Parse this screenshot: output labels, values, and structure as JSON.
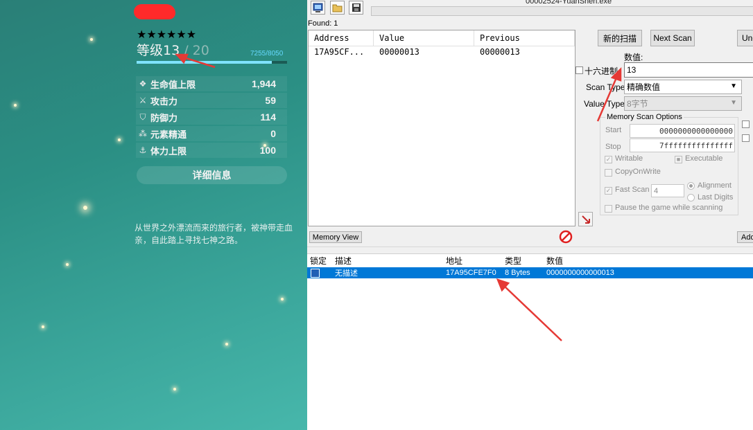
{
  "game": {
    "stars": "★★★★★★",
    "level_label": "等级13",
    "level_max": " / 20",
    "exp": "7255/8050",
    "exp_fraction": 0.9,
    "stats": [
      {
        "icon": "hp-icon",
        "name": "生命值上限",
        "value": "1,944"
      },
      {
        "icon": "sword-icon",
        "name": "攻击力",
        "value": "59"
      },
      {
        "icon": "shield-icon",
        "name": "防御力",
        "value": "114"
      },
      {
        "icon": "element-icon",
        "name": "元素精通",
        "value": "0"
      },
      {
        "icon": "stamina-icon",
        "name": "体力上限",
        "value": "100"
      }
    ],
    "detail_button": "详细信息",
    "description": "从世界之外漂流而来的旅行者，被神带走血亲，自此踏上寻找七神之路。"
  },
  "ce": {
    "window_title": "00002524-YuanShen.exe",
    "found": "Found: 1",
    "results_headers": [
      "Address",
      "Value",
      "Previous"
    ],
    "results_rows": [
      {
        "address": "17A95CF...",
        "value": "00000013",
        "previous": "00000013"
      }
    ],
    "new_scan_button": "新的扫描",
    "next_scan_button": "Next Scan",
    "undo_scan_button": "Und",
    "value_label": "数值:",
    "hex_label": "十六进制",
    "value_input": "13",
    "scan_type_label": "Scan Type",
    "scan_type_value": "精确数值",
    "value_type_label": "Value Type",
    "value_type_value": "8字节",
    "memory_scan_options": "Memory Scan Options",
    "start_label": "Start",
    "start_value": "0000000000000000",
    "stop_label": "Stop",
    "stop_value": "7fffffffffffffff",
    "writable_label": "Writable",
    "executable_label": "Executable",
    "copyonwrite_label": "CopyOnWrite",
    "fast_scan_label": "Fast Scan",
    "fast_scan_value": "4",
    "alignment_label": "Alignment",
    "last_digits_label": "Last Digits",
    "pause_label": "Pause the game while scanning",
    "memory_view_button": "Memory View",
    "add_address_button": "Add",
    "address_list_headers": [
      "锁定",
      "描述",
      "地址",
      "类型",
      "数值"
    ],
    "address_list_rows": [
      {
        "description": "无描述",
        "address": "17A95CFE7F0",
        "type": "8 Bytes",
        "value": "0000000000000013"
      }
    ]
  },
  "annotation_color": "#e53935"
}
